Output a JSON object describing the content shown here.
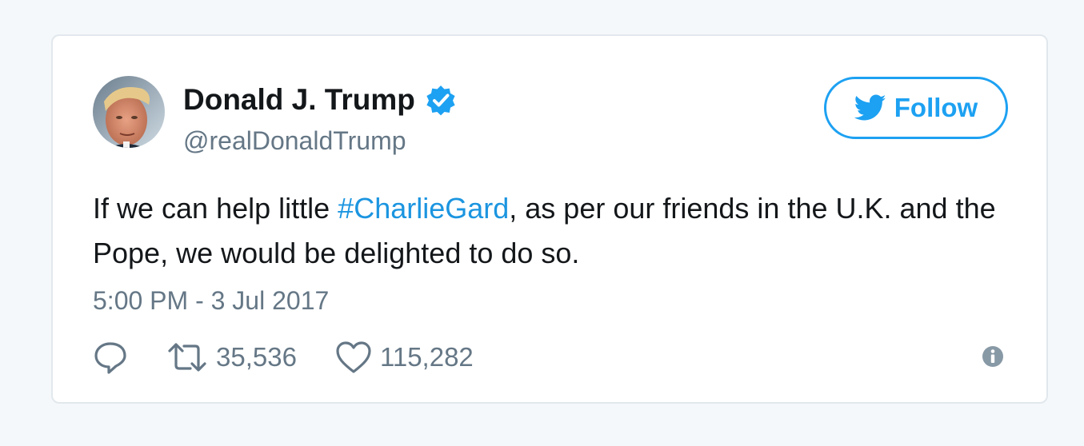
{
  "tweet": {
    "author": {
      "display_name": "Donald J. Trump",
      "handle": "@realDonaldTrump",
      "verified": true
    },
    "follow_label": "Follow",
    "text_before": "If we can help little ",
    "hashtag": "#CharlieGard",
    "text_after": ", as per our friends in the U.K. and the Pope, we would be delighted to do so.",
    "timestamp": "5:00 PM - 3 Jul 2017",
    "retweet_count": "35,536",
    "like_count": "115,282"
  },
  "icons": {
    "verified": "verified-badge-icon",
    "follow": "twitter-bird-icon",
    "reply": "reply-icon",
    "retweet": "retweet-icon",
    "like": "heart-icon",
    "info": "info-icon"
  },
  "colors": {
    "accent": "#1da1f2",
    "link": "#1b95e0",
    "text": "#14171a",
    "muted": "#657786",
    "border": "#e1e8ed"
  }
}
